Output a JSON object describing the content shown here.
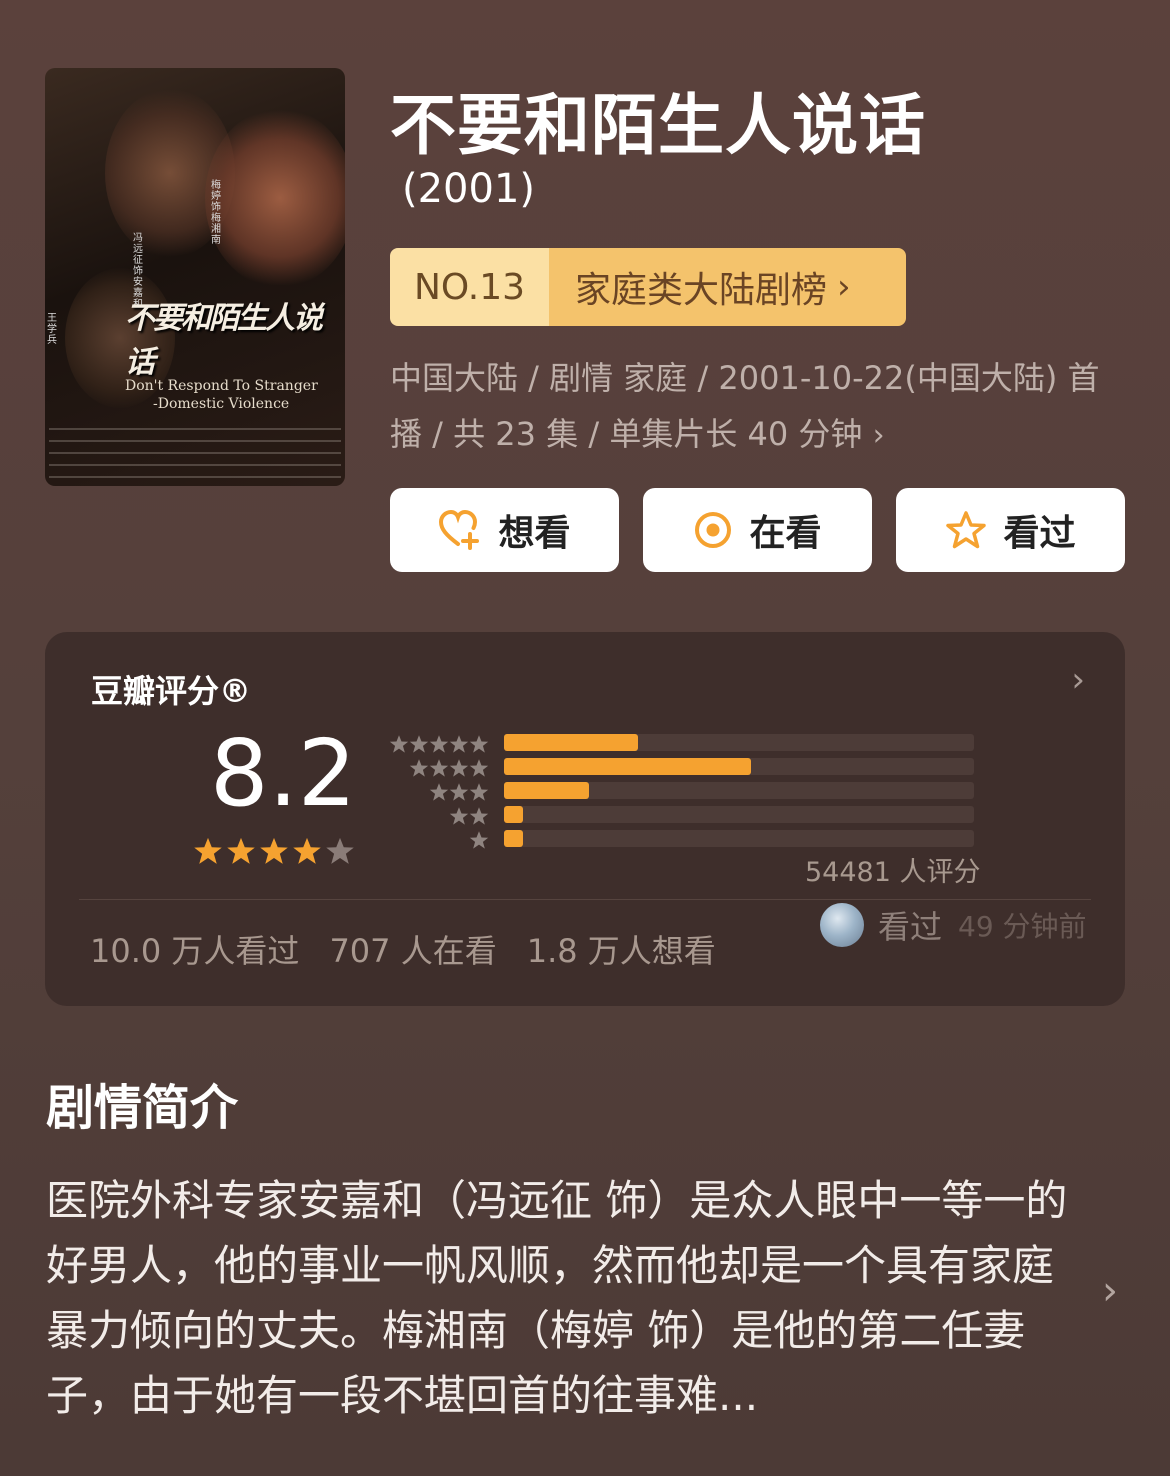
{
  "poster": {
    "title": "不要和陌生人说话",
    "english_line1": "Don't  Respond To Stranger",
    "english_line2": "-Domestic Violence",
    "cast": [
      "梅婷 饰梅湘南",
      "冯远征 饰安嘉和",
      "王学兵"
    ]
  },
  "title": "不要和陌生人说话",
  "year": "(2001)",
  "rank": {
    "number": "NO.13",
    "label": "家庭类大陆剧榜",
    "chevron": "›"
  },
  "meta": {
    "line1": "中国大陆 / 剧情 家庭 / 2001-10-22(中国大陆) 首",
    "line2": "播 / 共 23 集 / 单集片长 40 分钟",
    "chevron": "›"
  },
  "actions": {
    "want": "想看",
    "watching": "在看",
    "watched": "看过"
  },
  "rating": {
    "label": "豆瓣评分®",
    "chevron": "›",
    "score": "8.2",
    "stars_value": 4,
    "stars_max": 5,
    "distribution": [
      {
        "stars": 5,
        "fraction": 0.285
      },
      {
        "stars": 4,
        "fraction": 0.525
      },
      {
        "stars": 3,
        "fraction": 0.18
      },
      {
        "stars": 2,
        "fraction": 0.04
      },
      {
        "stars": 1,
        "fraction": 0.04
      }
    ],
    "count_text": "54481 人评分",
    "stats": {
      "watched": "10.0 万人看过",
      "watching": "707 人在看",
      "want": "1.8 万人想看"
    },
    "friend": {
      "action": "看过",
      "time": "49 分钟前"
    }
  },
  "synopsis": {
    "heading": "剧情简介",
    "text": "医院外科专家安嘉和（冯远征 饰）是众人眼中一等一的好男人，他的事业一帆风顺，然而他却是一个具有家庭暴力倾向的丈夫。梅湘南（梅婷 饰）是他的第二任妻子，由于她有一段不堪回首的往事难...",
    "chevron": "›"
  },
  "colors": {
    "background": "#5a403b",
    "card": "#3e2e2b",
    "accent_orange": "#f5a230",
    "rank_light": "#fbe0a4",
    "rank_gold": "#f4c36c"
  }
}
